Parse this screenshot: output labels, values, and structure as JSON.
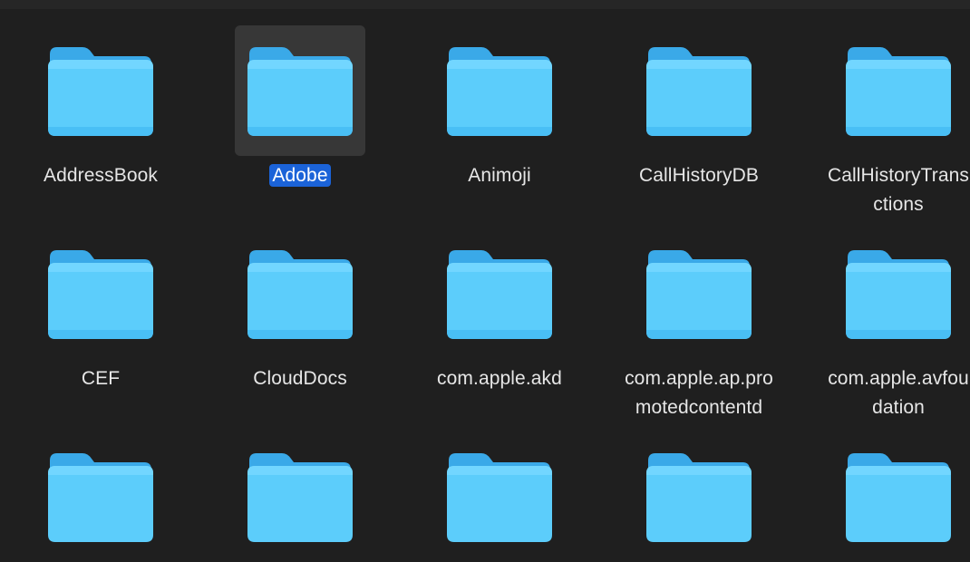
{
  "folders": [
    {
      "name": "AddressBook",
      "selected": false
    },
    {
      "name": "Adobe",
      "selected": true
    },
    {
      "name": "Animoji",
      "selected": false
    },
    {
      "name": "CallHistoryDB",
      "selected": false
    },
    {
      "name": "CallHistoryTrans\nctions",
      "selected": false
    },
    {
      "name": "CEF",
      "selected": false
    },
    {
      "name": "CloudDocs",
      "selected": false
    },
    {
      "name": "com.apple.akd",
      "selected": false
    },
    {
      "name": "com.apple.ap.pro\nmotedcontentd",
      "selected": false
    },
    {
      "name": "com.apple.avfou\ndation",
      "selected": false
    },
    {
      "name": "",
      "selected": false
    },
    {
      "name": "",
      "selected": false
    },
    {
      "name": "",
      "selected": false
    },
    {
      "name": "",
      "selected": false
    },
    {
      "name": "",
      "selected": false
    }
  ],
  "colors": {
    "background": "#1f1f1f",
    "folder_body": "#5ccdfb",
    "folder_back": "#39a9e8",
    "selection_bg": "#373737",
    "label_selected_bg": "#1b63d8",
    "label_text": "#e6e6e6"
  },
  "icon": "folder-icon"
}
